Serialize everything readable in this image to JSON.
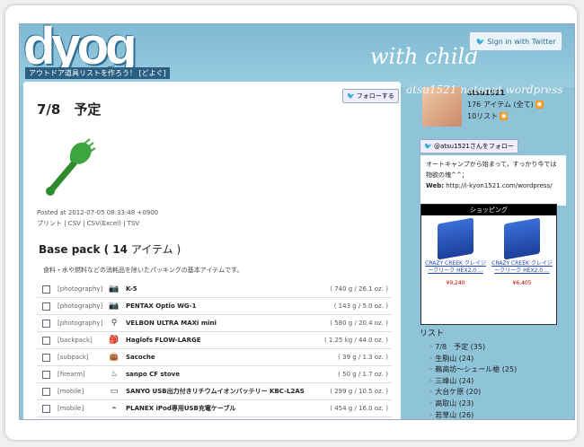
{
  "header": {
    "logo": "dyog",
    "tagline": "アウトドア道具リストを作ろう！ [どよぐ]",
    "subtitle": "with child",
    "twitter_button": "Sign in with Twitter",
    "watermark": "atsu1521  natonet wordpress"
  },
  "post": {
    "follow_button": "フォローする",
    "title": "7/8　予定",
    "posted": "Posted at 2012-07-05 08:33:48 +0900",
    "exports": "プリント | CSV | CSV(Excel) | TSV"
  },
  "pack": {
    "title_prefix": "Base pack ( ",
    "count": "14",
    "title_suffix": " アイテム )",
    "description": "食料・水や燃料などの消耗品を除いたパッキングの基本アイテムです。"
  },
  "items": [
    {
      "category": "[photography]",
      "icon": "camera-icon",
      "name": "K-5",
      "weight": "( 740 g / 26.1 oz. )"
    },
    {
      "category": "[photography]",
      "icon": "camera-icon",
      "name": "PENTAX Optio WG-1",
      "weight": "( 143 g / 5.0 oz. )"
    },
    {
      "category": "[photography]",
      "icon": "tripod-icon",
      "name": "VELBON ULTRA MAXi mini",
      "weight": "( 580 g / 20.4 oz. )"
    },
    {
      "category": "[backpack]",
      "icon": "backpack-icon",
      "name": "Haglofs FLOW-LARGE",
      "weight": "( 1.25 kg / 44.0 oz. )"
    },
    {
      "category": "[subpack]",
      "icon": "bag-icon",
      "name": "Sacoche",
      "weight": "( 39 g / 1.3 oz. )"
    },
    {
      "category": "[firearm]",
      "icon": "stove-icon",
      "name": "sanpo CF stove",
      "weight": "( 50 g / 1.7 oz. )"
    },
    {
      "category": "[mobile]",
      "icon": "battery-icon",
      "name": "SANYO USB出力付きリチウムイオンバッテリー KBC-L2AS",
      "weight": "( 299 g / 10.5 oz. )"
    },
    {
      "category": "[mobile]",
      "icon": "cable-icon",
      "name": "PLANEX iPod専用USB充電ケーブル",
      "weight": "( 454 g / 16.0 oz. )"
    }
  ],
  "profile": {
    "username": "atsu1521",
    "items": "176 アイテム (全て)",
    "lists": "10リスト",
    "follow_button": "@atsu1521さんをフォロー",
    "bio": "オートキャンプから始まって，すっかり今では物欲の塊^^；",
    "web_label": "Web:",
    "web_url": "http://i-kyon1521.com/wordpress/"
  },
  "shop": {
    "title": "ショッピング",
    "products": [
      {
        "name": "CRAZY CREEK クレイジークリーク HEX2.0 ...",
        "price": "¥9,240"
      },
      {
        "name": "CRAZY CREEK クレイジークリーク HEX2.0 ...",
        "price": "¥6,405"
      }
    ]
  },
  "lists": {
    "heading": "リスト",
    "entries": [
      "7/8　予定 (35)",
      "生駒山 (24)",
      "鵜高坊～シェール槍 (25)",
      "三峰山 (24)",
      "大台ケ原 (20)",
      "高取山 (23)",
      "若草山 (26)"
    ]
  }
}
